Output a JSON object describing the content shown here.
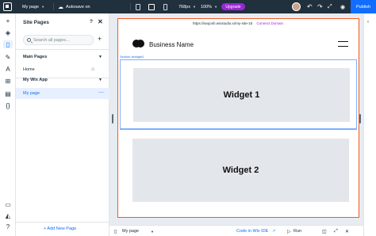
{
  "topbar": {
    "page_selector": "My page",
    "autosave": "Autosave on",
    "width_value": "768px",
    "zoom_value": "100%",
    "upgrade_label": "Upgrade",
    "publish_label": "Publish"
  },
  "panel": {
    "title": "Site Pages",
    "help_label": "?",
    "close_label": "✕",
    "search_placeholder": "Search all pages...",
    "add_label": "+",
    "sections": [
      {
        "label": "Main Pages",
        "pages": [
          {
            "label": "Home"
          }
        ]
      },
      {
        "label": "My Wix App",
        "pages": [
          {
            "label": "My page"
          }
        ]
      }
    ],
    "add_new_page_label": "+ Add New Page"
  },
  "canvas": {
    "url": "https://iwojosh.wixstudio.io/my-site-15",
    "connect_domain": "Connect Domain",
    "business_name": "Business Name",
    "section_tag": "Section #widget1",
    "widgets": [
      {
        "label": "Widget 1"
      },
      {
        "label": "Widget 2"
      }
    ]
  },
  "bottombar": {
    "page_label": "My page",
    "code_ide": "Code in Wix IDE",
    "run_label": "Run"
  },
  "colors": {
    "topbar_bg": "#20303c",
    "accent_blue": "#116dff",
    "upgrade_purple": "#9a27d5",
    "selection_orange": "#f05a24"
  }
}
